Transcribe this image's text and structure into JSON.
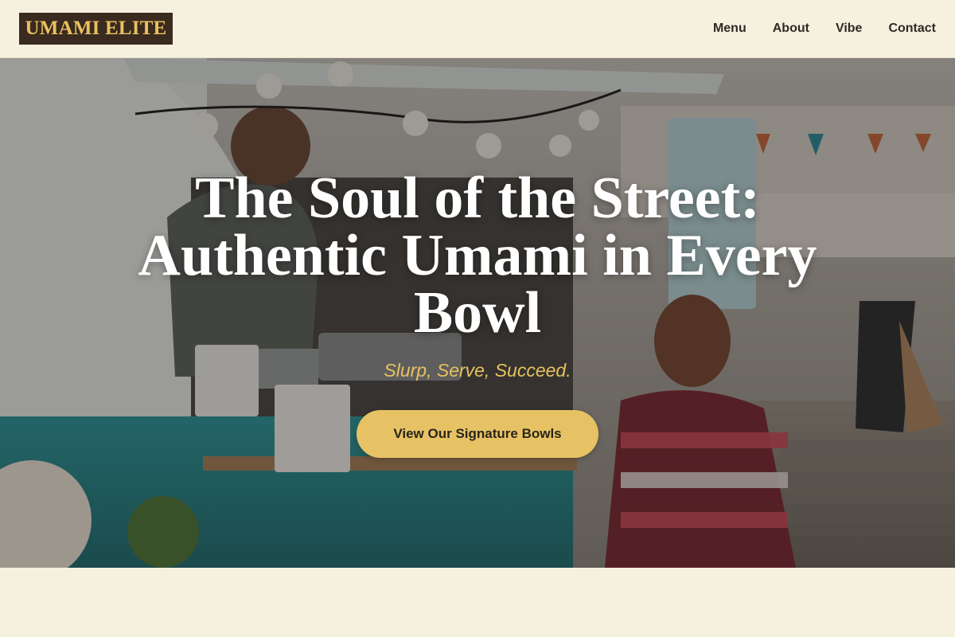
{
  "brand": {
    "logo_text": "UMAMI ELITE"
  },
  "nav": {
    "items": [
      {
        "label": "Menu"
      },
      {
        "label": "About"
      },
      {
        "label": "Vibe"
      },
      {
        "label": "Contact"
      }
    ]
  },
  "hero": {
    "headline": "The Soul of the Street: Authentic Umami in Every Bowl",
    "tagline": "Slurp, Serve, Succeed.",
    "cta_label": "View Our Signature Bowls",
    "image_description_icon": "food-truck-photo"
  },
  "colors": {
    "background": "#f6f0de",
    "logo_bg": "#3a2a1f",
    "accent_gold": "#e8c25f",
    "cta_bg": "#e6c264",
    "nav_text": "#2d2a25"
  }
}
